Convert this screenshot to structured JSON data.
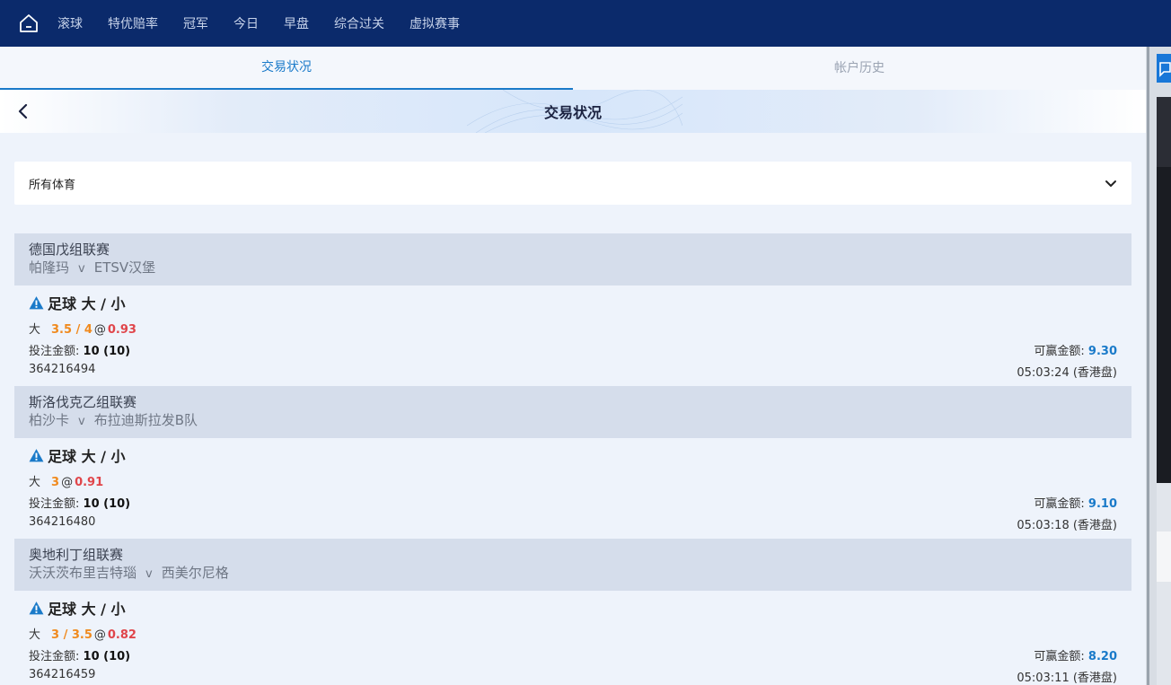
{
  "nav": {
    "items": [
      "滚球",
      "特优赔率",
      "冠军",
      "今日",
      "早盘",
      "综合过关",
      "虚拟赛事"
    ]
  },
  "tabs": [
    "交易状况",
    "帐户历史"
  ],
  "header": {
    "title": "交易状况"
  },
  "filter": {
    "label": "所有体育"
  },
  "labels": {
    "stake": "投注金额:",
    "win": "可赢金额:",
    "vs": "v",
    "at": "@"
  },
  "bets": [
    {
      "league": "德国戊组联赛",
      "home": "帕隆玛",
      "away": "ETSV汉堡",
      "market": "足球 大 / 小",
      "selection": "大",
      "line": "3.5 / 4",
      "odds": "0.93",
      "stake": "10 (10)",
      "win": "9.30",
      "id": "364216494",
      "time": "05:03:24 (香港盘)"
    },
    {
      "league": "斯洛伐克乙组联赛",
      "home": "柏沙卡",
      "away": "布拉迪斯拉发B队",
      "market": "足球 大 / 小",
      "selection": "大",
      "line": "3",
      "odds": "0.91",
      "stake": "10 (10)",
      "win": "9.10",
      "id": "364216480",
      "time": "05:03:18 (香港盘)"
    },
    {
      "league": "奥地利丁组联赛",
      "home": "沃沃茨布里吉特瑙",
      "away": "西美尔尼格",
      "market": "足球 大 / 小",
      "selection": "大",
      "line": "3 / 3.5",
      "odds": "0.82",
      "stake": "10 (10)",
      "win": "8.20",
      "id": "364216459",
      "time": "05:03:11 (香港盘)"
    }
  ],
  "colors": {
    "nav_bg": "#0b2a6b",
    "accent": "#1a7ac9",
    "line": "#f08a1e",
    "odds": "#e0454a"
  }
}
